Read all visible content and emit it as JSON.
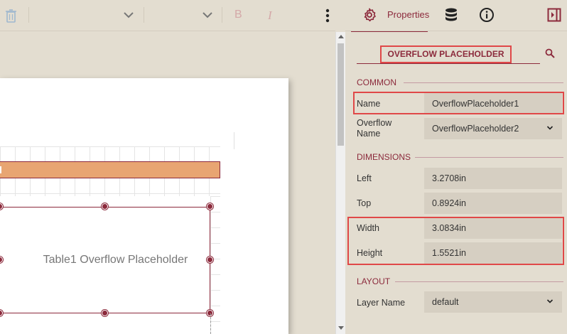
{
  "toolbar": {
    "bold_label": "B",
    "italic_label": "I"
  },
  "header": {
    "properties_tab": "Properties"
  },
  "canvas": {
    "placeholder_text": "Table1 Overflow Placeholder"
  },
  "panel": {
    "title": "OVERFLOW PLACEHOLDER",
    "sections": {
      "common": "COMMON",
      "dimensions": "DIMENSIONS",
      "layout": "LAYOUT"
    },
    "fields": {
      "name_label": "Name",
      "name_value": "OverflowPlaceholder1",
      "overflow_label": "Overflow Name",
      "overflow_value": "OverflowPlaceholder2",
      "left_label": "Left",
      "left_value": "3.2708in",
      "top_label": "Top",
      "top_value": "0.8924in",
      "width_label": "Width",
      "width_value": "3.0834in",
      "height_label": "Height",
      "height_value": "1.5521in",
      "layer_label": "Layer Name",
      "layer_value": "default"
    }
  },
  "colors": {
    "accent": "#8c2a3c",
    "highlight": "#e04848",
    "header_row": "#e8a572",
    "panel_bg": "#e3ddd0",
    "field_bg": "#d6cfc2"
  }
}
